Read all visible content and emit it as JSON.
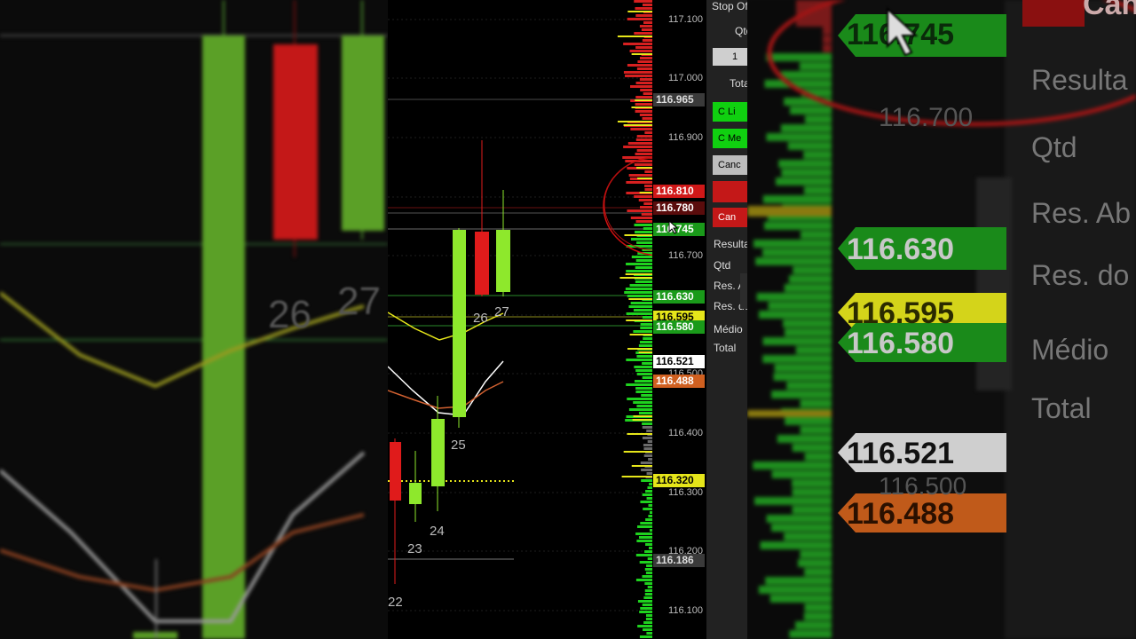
{
  "chart": {
    "bar_numbers": [
      "22",
      "23",
      "24",
      "25",
      "26",
      "27"
    ],
    "colors": {
      "up": "#8ee82c",
      "down": "#e01b1b",
      "bid": "#1fd21f",
      "ask": "#d62020",
      "highlight": "#e6e61a"
    }
  },
  "price_axis": {
    "ticks": [
      "117.100",
      "117.000",
      "116.900",
      "116.700",
      "116.500",
      "116.400",
      "116.300",
      "116.200",
      "116.100"
    ],
    "tags": [
      {
        "value": "116.965",
        "style": "gray"
      },
      {
        "value": "116.810",
        "style": "red"
      },
      {
        "value": "116.780",
        "style": "darkred"
      },
      {
        "value": "116.745",
        "style": "green"
      },
      {
        "value": "116.630",
        "style": "green"
      },
      {
        "value": "116.595",
        "style": "yellow"
      },
      {
        "value": "116.580",
        "style": "green"
      },
      {
        "value": "116.521",
        "style": "white"
      },
      {
        "value": "116.488",
        "style": "orange"
      },
      {
        "value": "116.320",
        "style": "yellow"
      },
      {
        "value": "116.186",
        "style": "gray"
      }
    ]
  },
  "order_panel": {
    "stop_label": "Stop Of",
    "qty_label": "Qtd",
    "qty_value": "1",
    "total_label": "Total",
    "buy_limit_label": "C Li",
    "buy_market_label": "C Me",
    "cancel_label": "Canc",
    "cancel_all_label": "Can",
    "result_label": "Resulta",
    "qtd_label": "Qtd",
    "res_open_label": "Res. Ab",
    "res_day_label": "Res. do",
    "avg_label": "Médio",
    "total2_label": "Total"
  },
  "zoom_left": {
    "numbers": [
      "26",
      "27"
    ]
  },
  "zoom_right": {
    "tags": [
      "116.745",
      "116.700",
      "116.630",
      "116.595",
      "116.580",
      "116.521",
      "116.500",
      "116.488"
    ],
    "labels": [
      "Resulta",
      "Qtd",
      "Res. Ab",
      "Res. do",
      "Médio",
      "Total"
    ],
    "cancel_label": "Can"
  }
}
